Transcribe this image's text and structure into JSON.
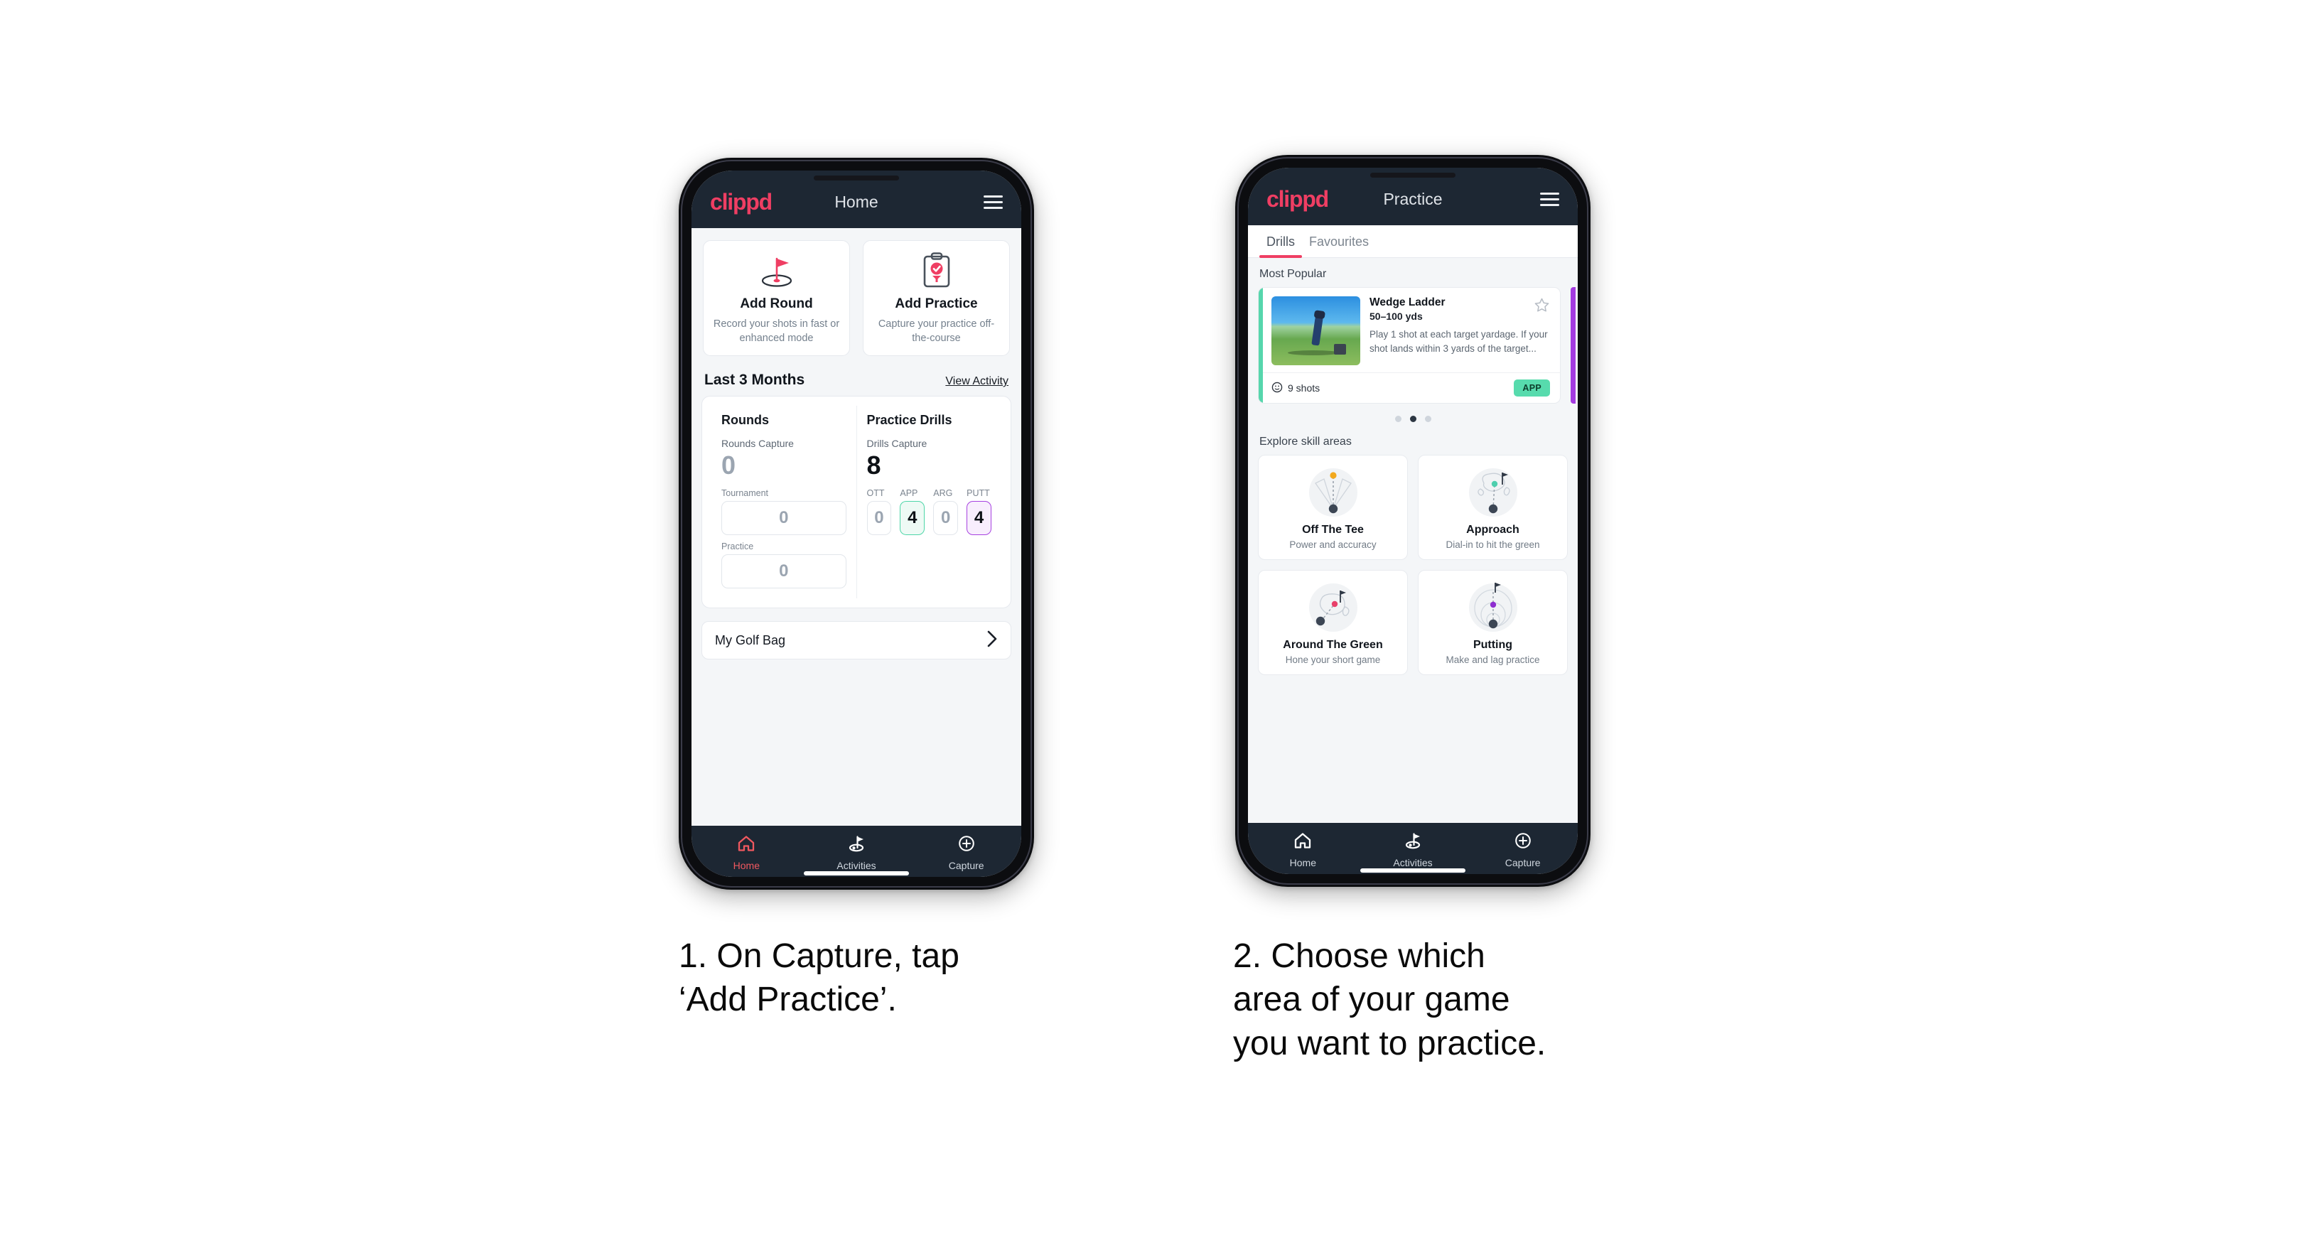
{
  "brand": "clippd",
  "phone_one": {
    "header": {
      "title": "Home",
      "menu_icon": "hamburger-menu-icon"
    },
    "actions": [
      {
        "icon": "golf-flag-hole-icon",
        "title": "Add Round",
        "subtitle": "Record your shots in fast or enhanced mode"
      },
      {
        "icon": "clipboard-check-icon",
        "title": "Add Practice",
        "subtitle": "Capture your practice off-the-course"
      }
    ],
    "section": {
      "title": "Last 3 Months",
      "link": "View Activity"
    },
    "stats": {
      "rounds": {
        "heading": "Rounds",
        "capture_label": "Rounds Capture",
        "capture_value": "0",
        "items": [
          {
            "label": "Tournament",
            "value": "0",
            "highlight": "none"
          },
          {
            "label": "Practice",
            "value": "0",
            "highlight": "none"
          }
        ]
      },
      "drills": {
        "heading": "Practice Drills",
        "capture_label": "Drills Capture",
        "capture_value": "8",
        "items": [
          {
            "label": "OTT",
            "value": "0",
            "highlight": "none"
          },
          {
            "label": "APP",
            "value": "4",
            "highlight": "green"
          },
          {
            "label": "ARG",
            "value": "0",
            "highlight": "none"
          },
          {
            "label": "PUTT",
            "value": "4",
            "highlight": "purple"
          }
        ]
      }
    },
    "golf_bag": {
      "label": "My Golf Bag",
      "chevron_icon": "chevron-right-icon"
    },
    "bottom_nav": [
      {
        "label": "Home",
        "icon": "home-icon",
        "active": true
      },
      {
        "label": "Activities",
        "icon": "golf-flag-icon",
        "active": false
      },
      {
        "label": "Capture",
        "icon": "plus-circle-icon",
        "active": false
      }
    ]
  },
  "phone_two": {
    "header": {
      "title": "Practice",
      "menu_icon": "hamburger-menu-icon"
    },
    "tabs": [
      {
        "label": "Drills",
        "active": true
      },
      {
        "label": "Favourites",
        "active": false
      }
    ],
    "most_popular_label": "Most Popular",
    "drill": {
      "name": "Wedge Ladder",
      "yardage": "50–100 yds",
      "description": "Play 1 shot at each target yardage. If your shot lands within 3 yards of the target...",
      "shots": "9 shots",
      "shots_icon": "clock-icon",
      "badge": "APP",
      "star_icon": "star-outline-icon",
      "accent_color": "#56d6ac",
      "next_accent_color": "#a43ae0",
      "thumb_icon": "golfer-photo"
    },
    "carousel_dots": {
      "count": 3,
      "active_index": 1
    },
    "explore_label": "Explore skill areas",
    "skill_areas": [
      {
        "name": "Off The Tee",
        "subtitle": "Power and accuracy",
        "icon": "tee-shot-fan-icon",
        "dot_color": "#f2a81d"
      },
      {
        "name": "Approach",
        "subtitle": "Dial-in to hit the green",
        "icon": "approach-green-icon",
        "dot_color": "#4ecfae"
      },
      {
        "name": "Around The Green",
        "subtitle": "Hone your short game",
        "icon": "chip-green-icon",
        "dot_color": "#e8406a"
      },
      {
        "name": "Putting",
        "subtitle": "Make and lag practice",
        "icon": "putting-rings-icon",
        "dot_color": "#8e2fd0"
      }
    ],
    "bottom_nav": [
      {
        "label": "Home",
        "icon": "home-icon",
        "active": false
      },
      {
        "label": "Activities",
        "icon": "golf-flag-icon",
        "active": false
      },
      {
        "label": "Capture",
        "icon": "plus-circle-icon",
        "active": false
      }
    ]
  },
  "captions": [
    "1. On Capture, tap\n‘Add Practice’.",
    "2. Choose which\narea of your game\nyou want to practice."
  ],
  "colors": {
    "brand_pink": "#ef3e63",
    "navy": "#1d2733",
    "green": "#56d6ac",
    "purple": "#a43ae0"
  }
}
